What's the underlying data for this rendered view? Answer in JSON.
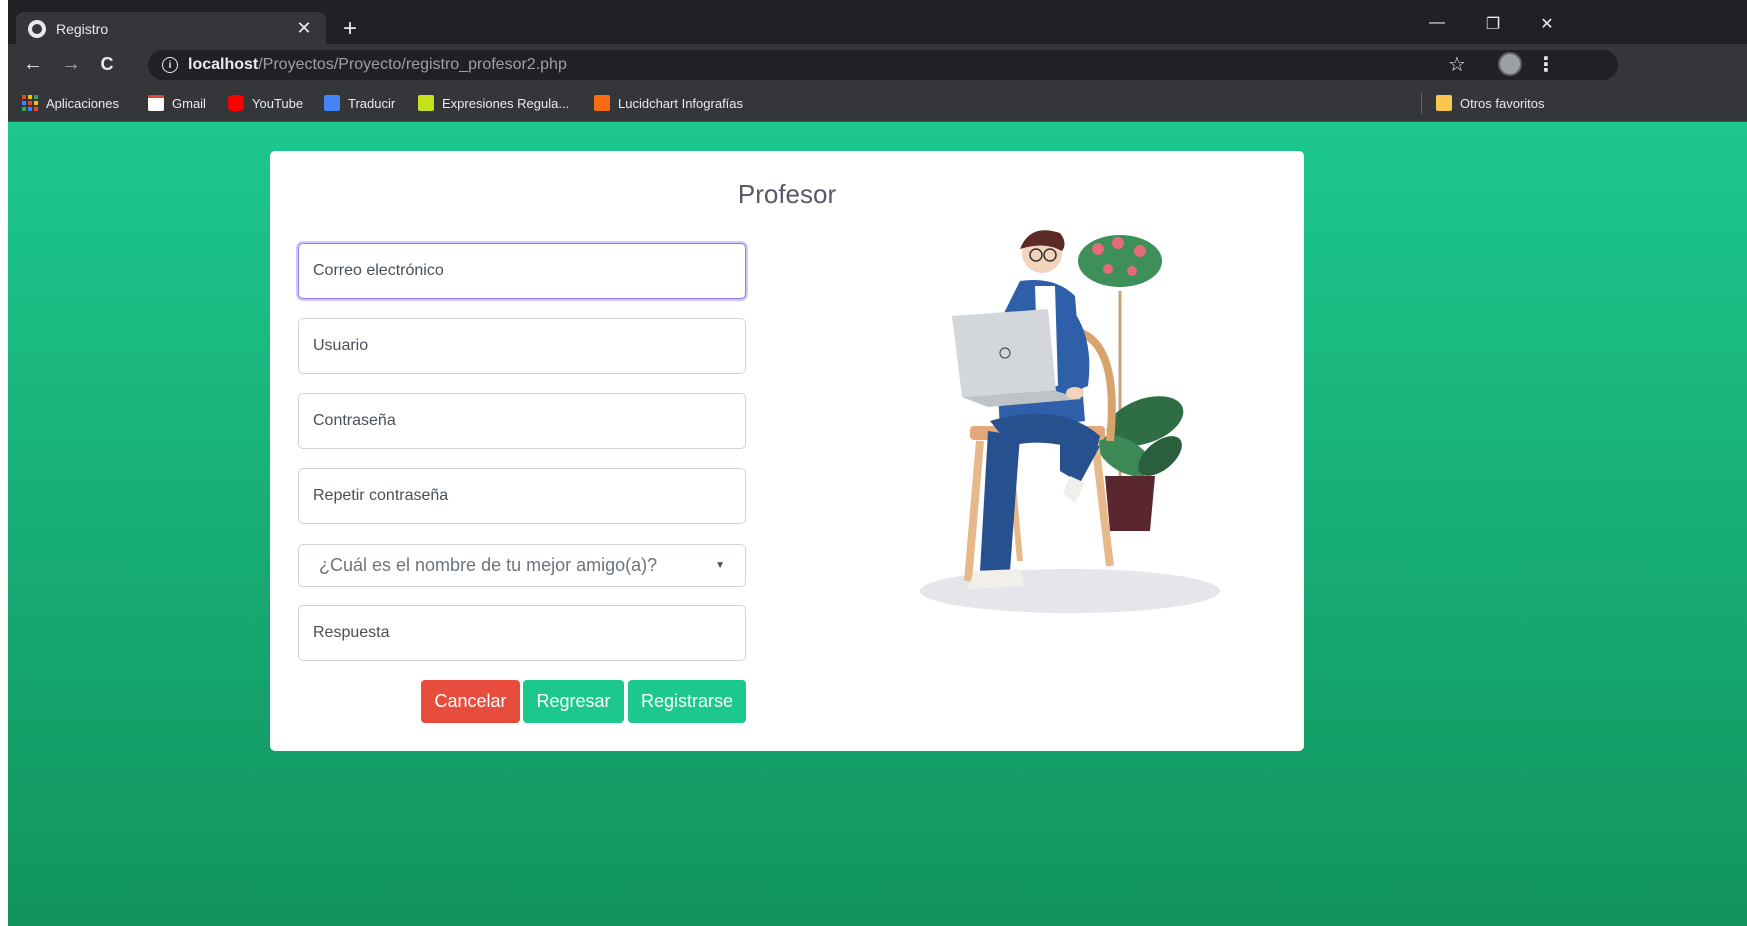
{
  "browser": {
    "tab": {
      "title": "Registro"
    },
    "url": {
      "host": "localhost",
      "path": "/Proyectos/Proyecto/registro_profesor2.php"
    },
    "bookmarks": [
      {
        "label": "Aplicaciones",
        "icon": "apps-grid-icon"
      },
      {
        "label": "Gmail",
        "icon": "gmail-icon"
      },
      {
        "label": "YouTube",
        "icon": "youtube-icon"
      },
      {
        "label": "Traducir",
        "icon": "translate-icon"
      },
      {
        "label": "Expresiones Regula...",
        "icon": "regex-icon"
      },
      {
        "label": "Lucidchart Infografías",
        "icon": "lucidchart-icon"
      }
    ],
    "other_bookmarks": "Otros favoritos"
  },
  "form": {
    "title": "Profesor",
    "email_placeholder": "Correo electrónico",
    "user_placeholder": "Usuario",
    "password_placeholder": "Contraseña",
    "repeat_password_placeholder": "Repetir contraseña",
    "security_question": "¿Cuál es el nombre de tu mejor amigo(a)?",
    "answer_placeholder": "Respuesta",
    "cancel_label": "Cancelar",
    "back_label": "Regresar",
    "register_label": "Registrarse"
  },
  "colors": {
    "accent_green": "#1dc88d",
    "cancel_red": "#e74c3c",
    "focus_ring": "#8e7cf0"
  }
}
